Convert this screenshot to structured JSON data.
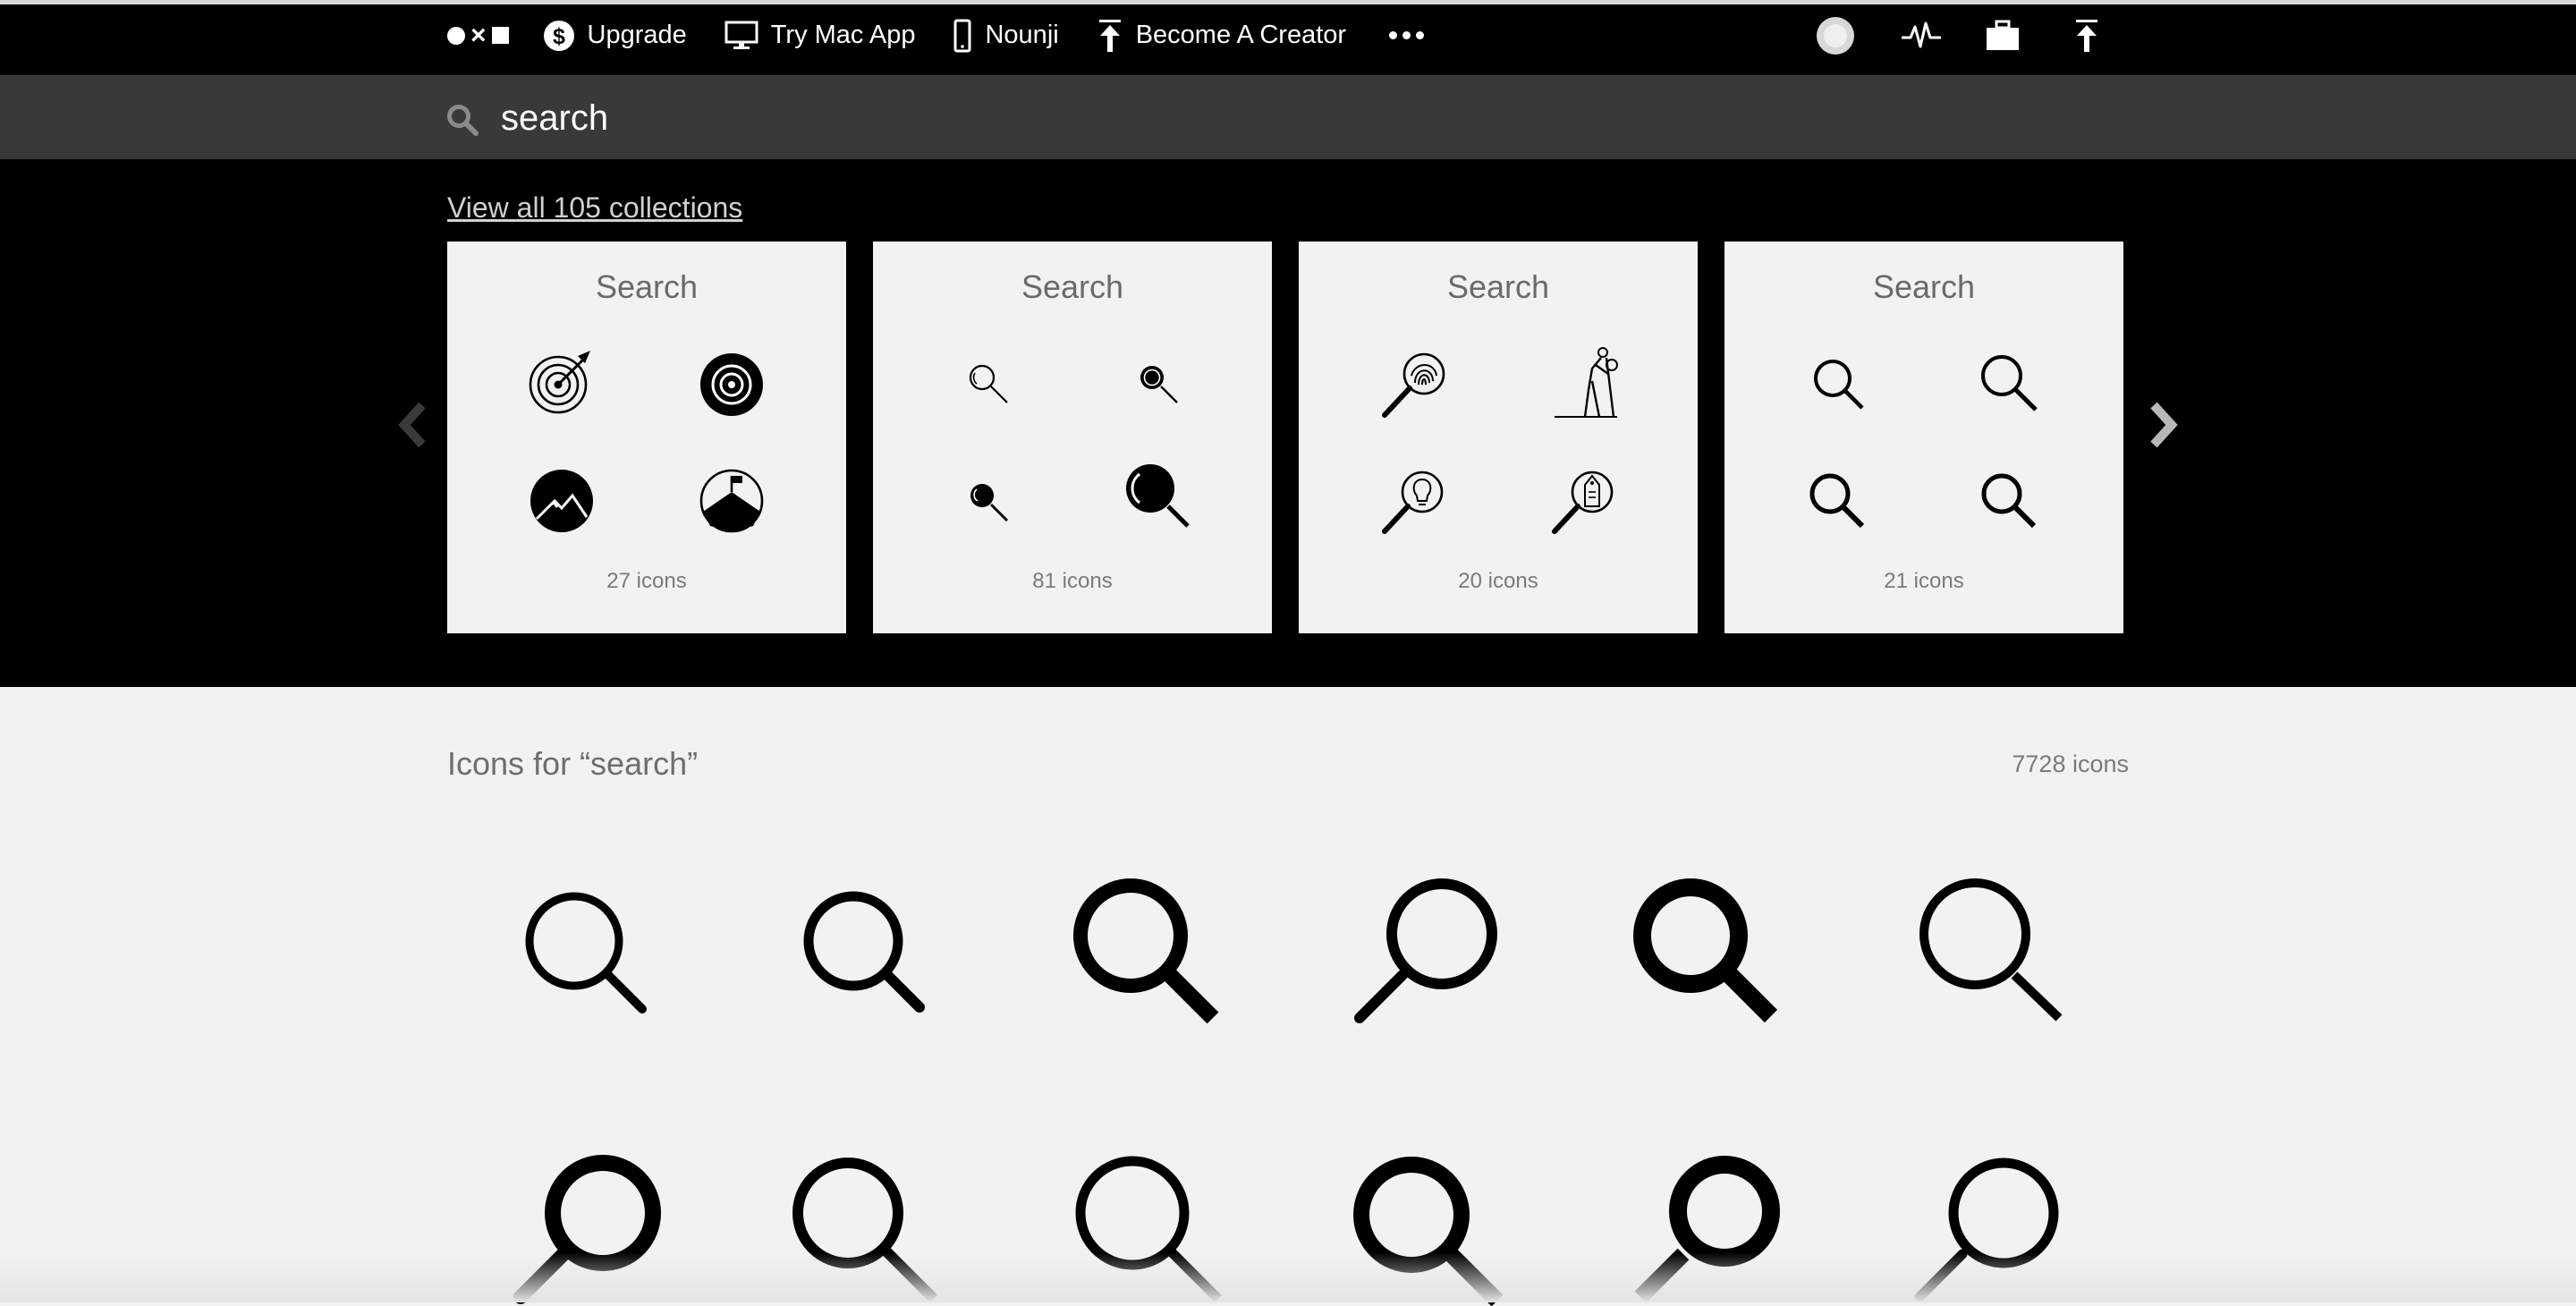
{
  "nav": {
    "upgrade": "Upgrade",
    "try_mac_app": "Try Mac App",
    "nounji": "Nounji",
    "become_creator": "Become A Creator",
    "more": "more-dots-icon",
    "logo_x": "×"
  },
  "search": {
    "value": "search",
    "placeholder": "search"
  },
  "collections": {
    "view_all": "View all 105 collections",
    "cards": [
      {
        "title": "Search",
        "count": "27 icons"
      },
      {
        "title": "Search",
        "count": "81 icons"
      },
      {
        "title": "Search",
        "count": "20 icons"
      },
      {
        "title": "Search",
        "count": "21 icons"
      }
    ]
  },
  "results": {
    "title": "Icons for “search”",
    "count": "7728 icons"
  },
  "colors": {
    "topbar": "#000000",
    "searchbar": "#393939",
    "card": "#f2f2f2",
    "page": "#f2f2f2",
    "muted_text": "#6e6e6e"
  }
}
